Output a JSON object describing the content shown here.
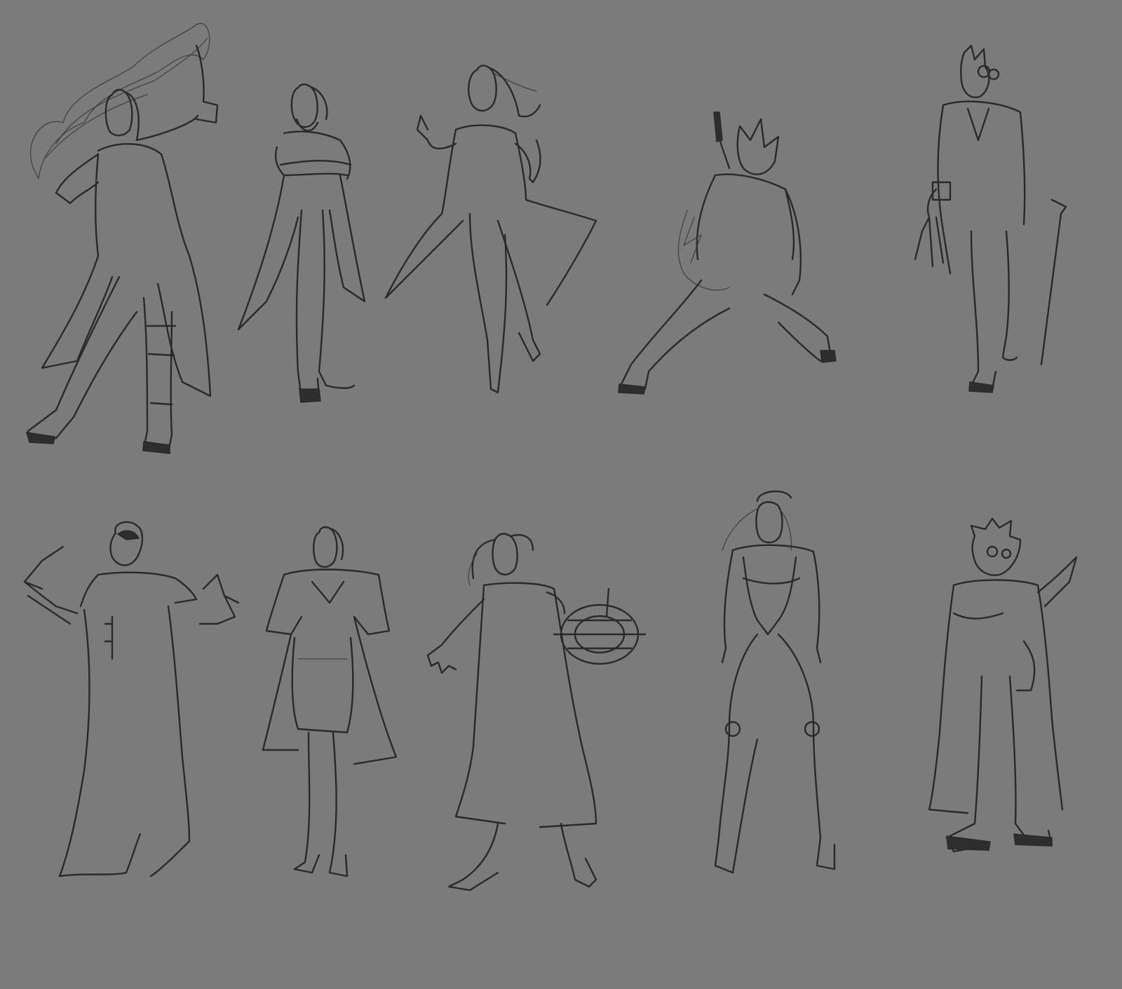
{
  "canvas": {
    "background_color": "#7b7b7b",
    "line_color": "#2a2a2a"
  },
  "figures": [
    {
      "id": 1,
      "name": "figure-caped-sorcerer-raising-smoke"
    },
    {
      "id": 2,
      "name": "figure-bearded-man-arms-crossed"
    },
    {
      "id": 3,
      "name": "figure-woman-long-hair-coat"
    },
    {
      "id": 4,
      "name": "figure-crouching-wild-hair-sword"
    },
    {
      "id": 5,
      "name": "figure-goggles-suit-cane-claw"
    },
    {
      "id": 6,
      "name": "figure-robed-helmet-claws"
    },
    {
      "id": 7,
      "name": "figure-woman-short-jacket-hands-on-hips"
    },
    {
      "id": 8,
      "name": "figure-coat-mechanical-arm-cannon"
    },
    {
      "id": 9,
      "name": "figure-android-bodysuit-headband"
    },
    {
      "id": 10,
      "name": "figure-spiky-hair-glasses-lab-coat"
    }
  ]
}
